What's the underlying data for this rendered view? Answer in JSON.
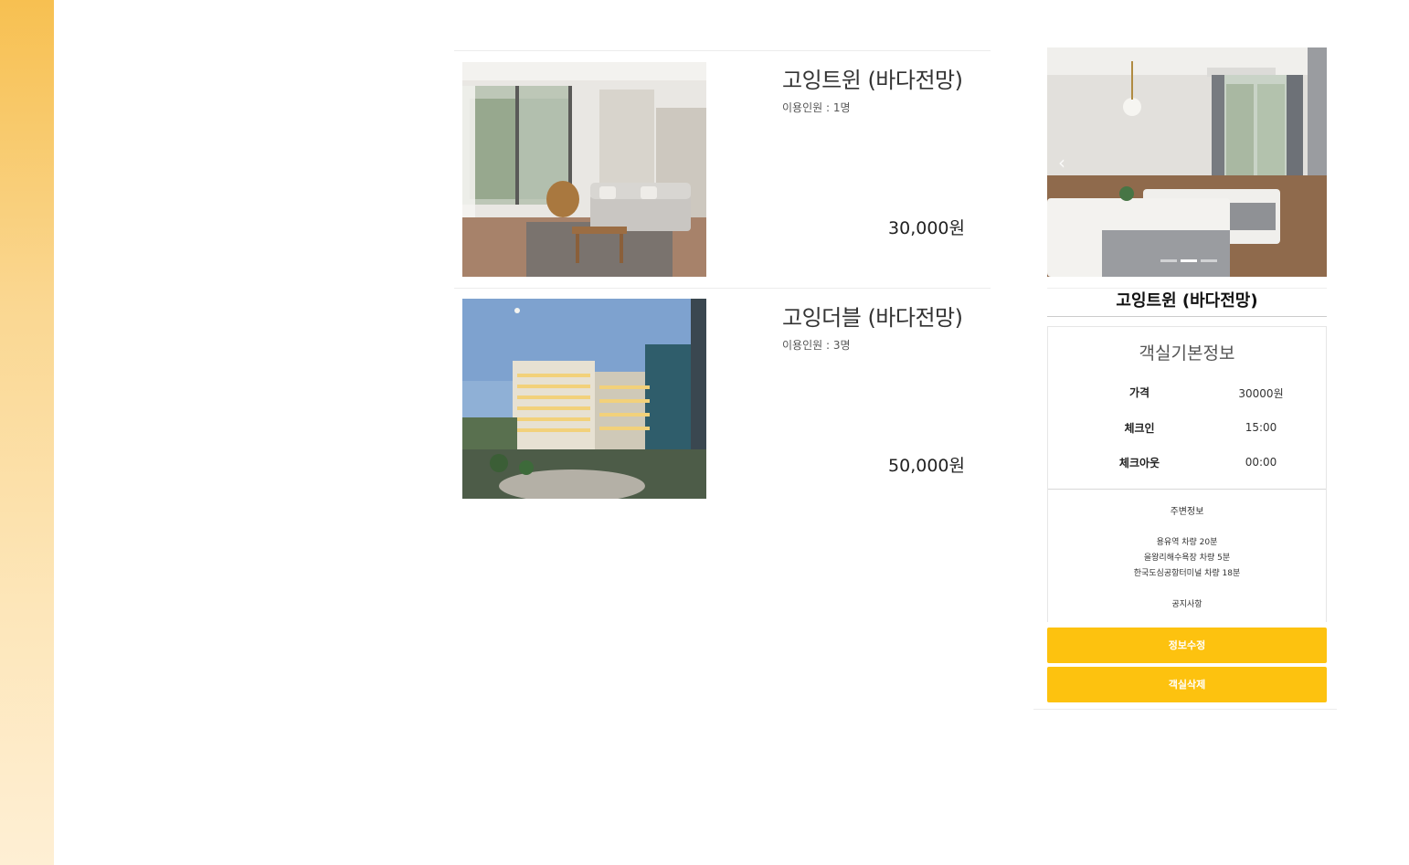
{
  "rooms": [
    {
      "name": "고잉트윈 (바다전망)",
      "capacity": "이용인원 : 1명",
      "price": "30,000원",
      "image": "living-room-photo"
    },
    {
      "name": "고잉더블 (바다전망)",
      "capacity": "이용인원 : 3명",
      "price": "50,000원",
      "image": "hotel-building-photo"
    }
  ],
  "detail": {
    "title": "고잉트윈 (바다전망)",
    "info_heading": "객실기본정보",
    "rows": [
      {
        "label": "가격",
        "value": "30000원"
      },
      {
        "label": "체크인",
        "value": "15:00"
      },
      {
        "label": "체크아웃",
        "value": "00:00"
      }
    ],
    "nearby_title": "주변정보",
    "nearby": [
      "용유역 차량 20분",
      "을왕리해수욕장 차량 5분",
      "한국도심공항터미널 차량 18분"
    ],
    "notice": "공지사항",
    "prev_icon": "chevron-left-icon",
    "edit_label": "정보수정",
    "delete_label": "객실삭제"
  },
  "colors": {
    "accent": "#fdc20f",
    "side_strip_top": "#f7c051",
    "side_strip_bottom": "#feefd4"
  }
}
